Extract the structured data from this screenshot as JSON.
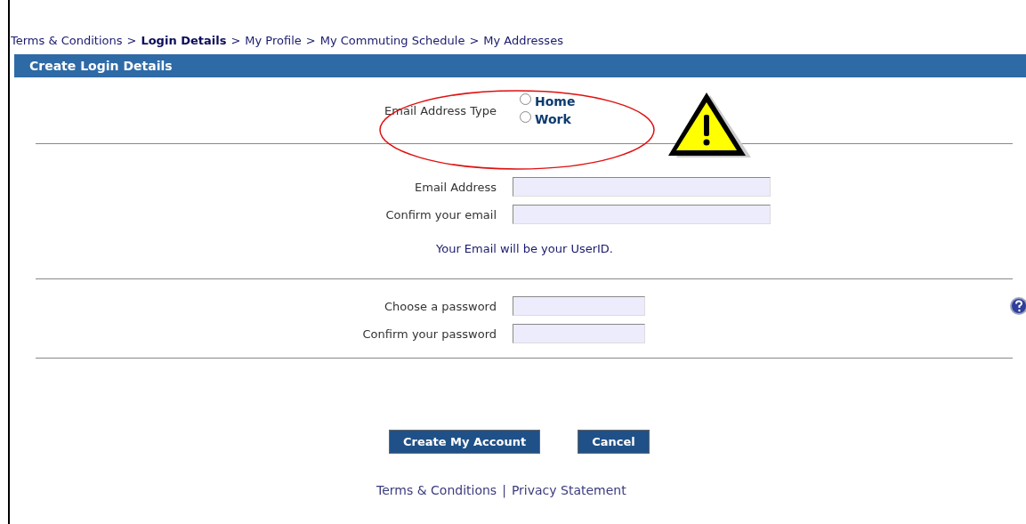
{
  "breadcrumb": [
    {
      "label": "Terms & Conditions",
      "selected": false
    },
    {
      "label": "Login Details",
      "selected": true
    },
    {
      "label": "My Profile",
      "selected": false
    },
    {
      "label": "My Commuting Schedule",
      "selected": false
    },
    {
      "label": "My Addresses",
      "selected": false
    }
  ],
  "breadcrumb_separator": ">",
  "section_title": "Create Login Details",
  "email_type": {
    "label": "Email Address Type",
    "options": [
      {
        "label": "Home",
        "selected": false
      },
      {
        "label": "Work",
        "selected": false
      }
    ]
  },
  "email_fields": [
    {
      "label": "Email Address"
    },
    {
      "label": "Confirm your email"
    }
  ],
  "email_note": "Your Email will be your UserID.",
  "password_fields": [
    {
      "label": "Choose a password"
    },
    {
      "label": "Confirm your password"
    }
  ],
  "buttons": [
    "Create My Account",
    "Cancel"
  ],
  "footer_links": [
    "Terms & Conditions",
    "Privacy Statement"
  ],
  "footer_separator": "|"
}
